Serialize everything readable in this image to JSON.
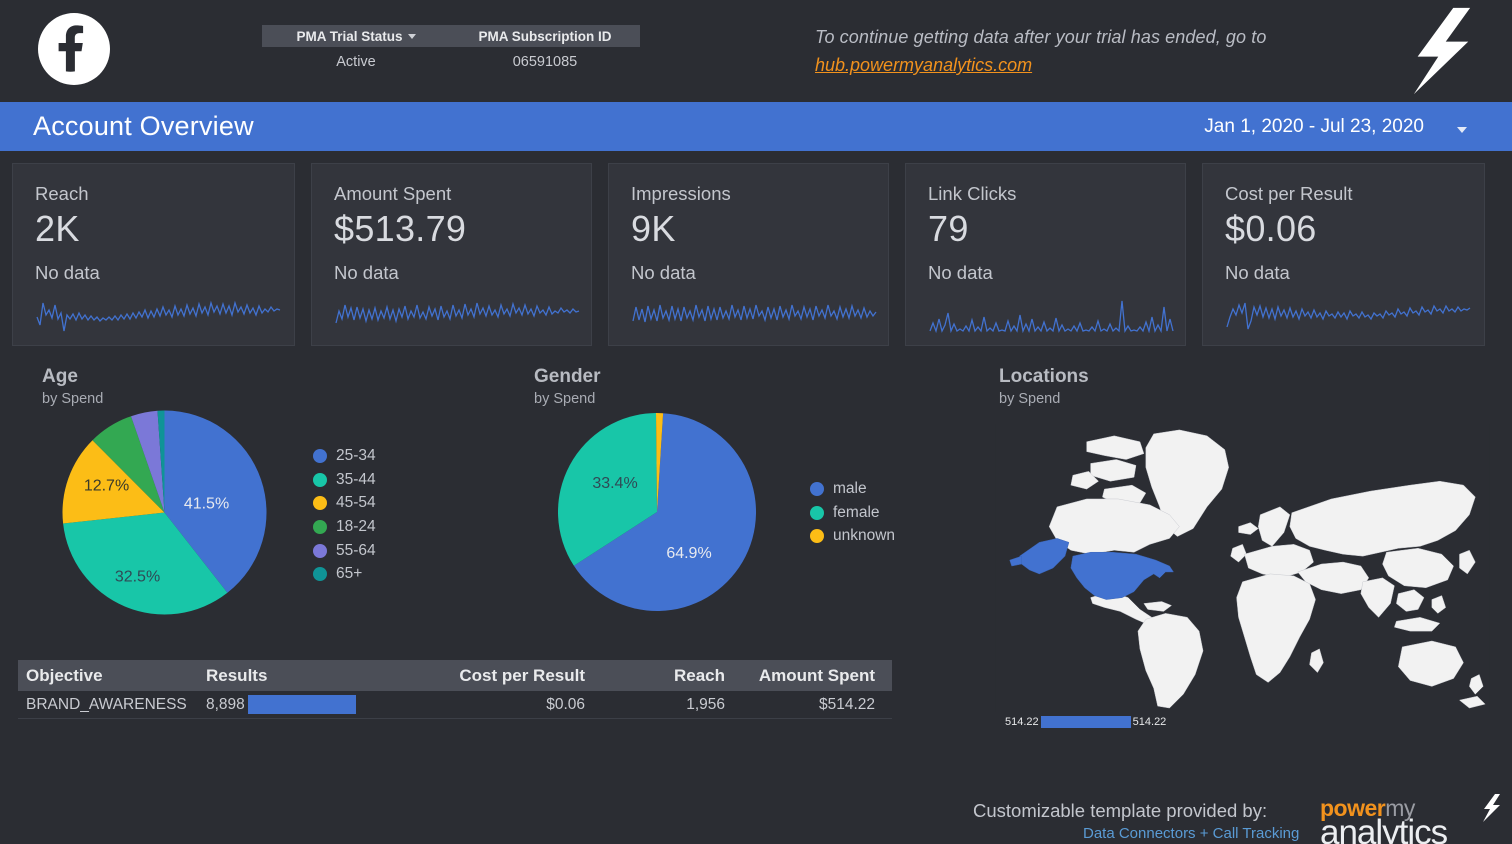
{
  "header": {
    "platform_icon": "facebook-icon",
    "bolt_icon": "lightning-bolt-icon",
    "pma_table": {
      "columns": [
        "PMA Trial Status",
        "PMA Subscription ID"
      ],
      "values": [
        "Active",
        "06591085"
      ]
    },
    "trial_message": "To continue getting data after your trial has ended, go to",
    "trial_link": "hub.powermyanalytics.com"
  },
  "titlebar": {
    "title": "Account Overview",
    "date_range": "Jan 1, 2020 - Jul 23, 2020",
    "caret_icon": "chevron-down-icon"
  },
  "kpis": [
    {
      "label": "Reach",
      "value": "2K",
      "comparison": "No data"
    },
    {
      "label": "Amount Spent",
      "value": "$513.79",
      "comparison": "No data"
    },
    {
      "label": "Impressions",
      "value": "9K",
      "comparison": "No data"
    },
    {
      "label": "Link Clicks",
      "value": "79",
      "comparison": "No data"
    },
    {
      "label": "Cost per Result",
      "value": "$0.06",
      "comparison": "No data"
    }
  ],
  "chart_data": [
    {
      "type": "pie",
      "title": "Age",
      "subtitle": "by Spend",
      "categories": [
        "25-34",
        "35-44",
        "45-54",
        "18-24",
        "55-64",
        "65+"
      ],
      "values": [
        41.5,
        32.5,
        12.7,
        8.0,
        4.2,
        1.1
      ],
      "labels": [
        "41.5%",
        "32.5%",
        "12.7%",
        "",
        "",
        ""
      ],
      "colors": [
        "#4272d0",
        "#18c6a8",
        "#fcbd16",
        "#33a852",
        "#7b78d8",
        "#0f9497"
      ],
      "legend_position": "right"
    },
    {
      "type": "pie",
      "title": "Gender",
      "subtitle": "by Spend",
      "categories": [
        "male",
        "female",
        "unknown"
      ],
      "values": [
        64.9,
        33.4,
        1.7
      ],
      "labels": [
        "64.9%",
        "33.4%",
        ""
      ],
      "colors": [
        "#4272d0",
        "#18c6a8",
        "#fcbd16"
      ],
      "legend_position": "right"
    },
    {
      "type": "map",
      "title": "Locations",
      "subtitle": "by Spend",
      "highlighted_regions": [
        "United States"
      ],
      "legend_min": "514.22",
      "legend_max": "514.22",
      "highlight_color": "#4272d0",
      "land_color": "#f2f2f2"
    }
  ],
  "table": {
    "columns": [
      "Objective",
      "Results",
      "Cost per Result",
      "Reach",
      "Amount Spent"
    ],
    "rows": [
      {
        "objective": "BRAND_AWARENESS",
        "results": "8,898",
        "cost_per_result": "$0.06",
        "reach": "1,956",
        "amount_spent": "$514.22",
        "results_bar_pct": 100
      }
    ]
  },
  "footer": {
    "text": "Customizable template provided by:",
    "link": "Data Connectors + Call Tracking",
    "logo_power": "power",
    "logo_my": "my",
    "logo_analytics": "analytics",
    "logo_bolt_icon": "lightning-bolt-icon"
  }
}
